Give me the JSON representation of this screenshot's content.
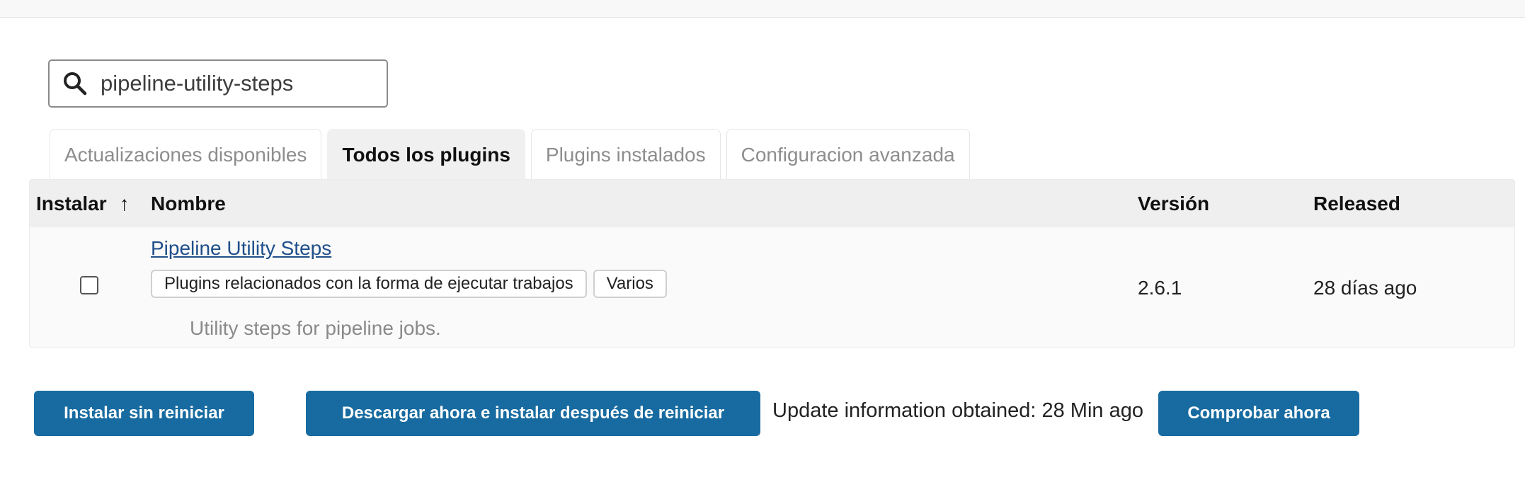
{
  "search": {
    "value": "pipeline-utility-steps"
  },
  "tabs": [
    {
      "label": "Actualizaciones disponibles",
      "active": false
    },
    {
      "label": "Todos los plugins",
      "active": true
    },
    {
      "label": "Plugins instalados",
      "active": false
    },
    {
      "label": "Configuracion avanzada",
      "active": false
    }
  ],
  "table": {
    "columns": {
      "install": "Instalar",
      "install_sort_icon": "↑",
      "name": "Nombre",
      "version": "Versión",
      "released": "Released"
    },
    "rows": [
      {
        "checked": false,
        "name": "Pipeline Utility Steps",
        "tags": [
          "Plugins relacionados con la forma de ejecutar trabajos",
          "Varios"
        ],
        "excerpt": "Utility steps for pipeline jobs.",
        "version": "2.6.1",
        "released": "28 días ago"
      }
    ]
  },
  "actions": {
    "install_without_restart": "Instalar sin reiniciar",
    "download_install_after_restart": "Descargar ahora e instalar después de reiniciar",
    "update_info": "Update information obtained: 28 Min ago",
    "check_now": "Comprobar ahora"
  },
  "colors": {
    "primary_button": "#186ba0",
    "link": "#1f4f8a",
    "header_bg": "#efefef"
  }
}
